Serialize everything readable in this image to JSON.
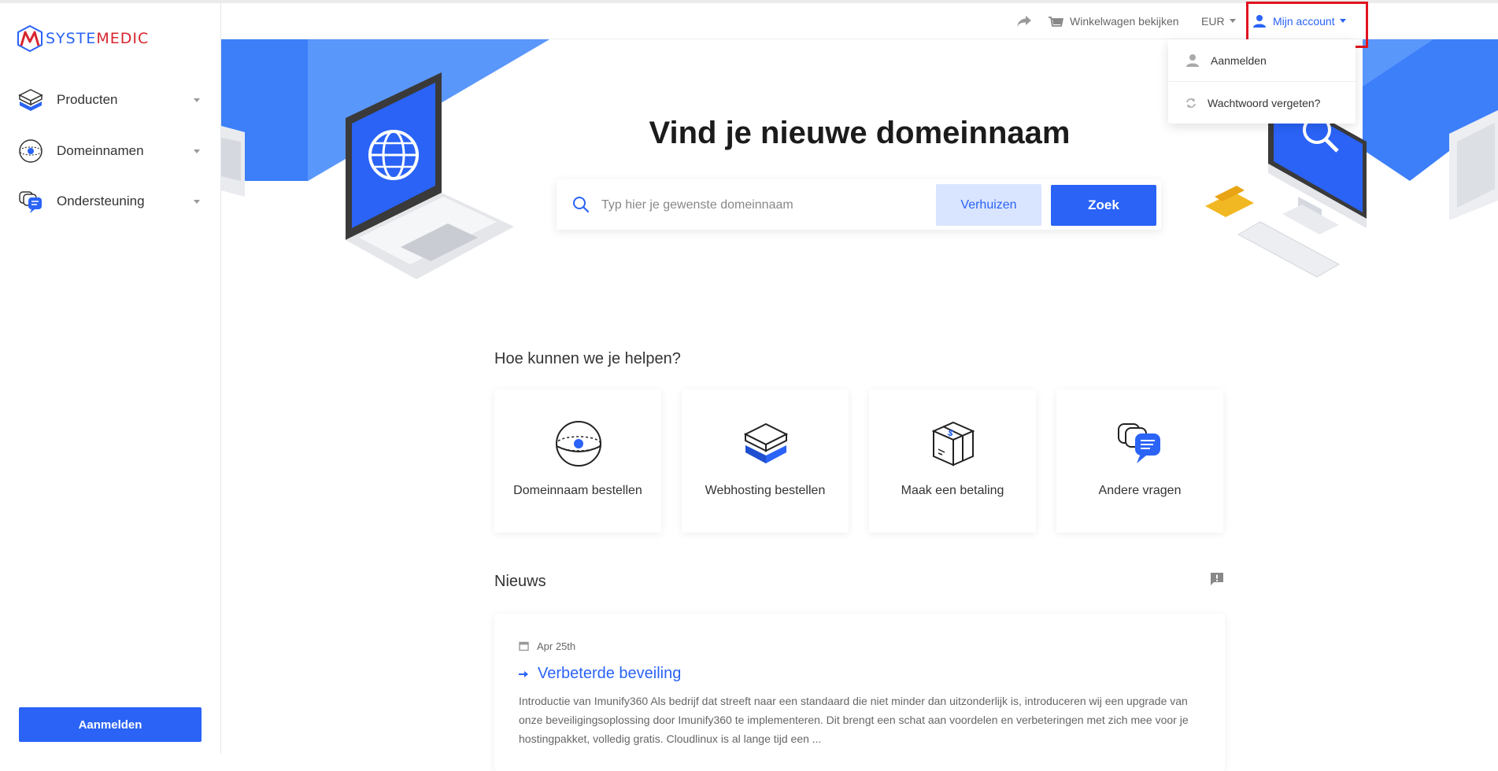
{
  "brand": {
    "logo_part1": "SYSTE",
    "logo_part2": "MEDIC",
    "primary_color": "#2a63f6",
    "accent_color": "#d7262f"
  },
  "sidebar": {
    "items": [
      {
        "label": "Producten",
        "icon": "server-icon"
      },
      {
        "label": "Domeinnamen",
        "icon": "globe-icon"
      },
      {
        "label": "Ondersteuning",
        "icon": "chat-bubbles-icon"
      }
    ],
    "login_button": "Aanmelden"
  },
  "topbar": {
    "cart_label": "Winkelwagen bekijken",
    "currency_label": "EUR",
    "account_label": "Mijn account"
  },
  "account_menu": {
    "items": [
      {
        "label": "Aanmelden",
        "icon": "user-icon"
      },
      {
        "label": "Wachtwoord vergeten?",
        "icon": "refresh-icon"
      }
    ]
  },
  "hero": {
    "title": "Vind je nieuwe domeinnaam",
    "search_placeholder": "Typ hier je gewenste domeinnaam",
    "transfer_button": "Verhuizen",
    "search_button": "Zoek"
  },
  "help": {
    "title": "Hoe kunnen we je helpen?",
    "cards": [
      {
        "label": "Domeinnaam bestellen",
        "icon": "globe-icon"
      },
      {
        "label": "Webhosting bestellen",
        "icon": "server-icon"
      },
      {
        "label": "Maak een betaling",
        "icon": "package-icon"
      },
      {
        "label": "Andere vragen",
        "icon": "chat-bubbles-icon"
      }
    ]
  },
  "news": {
    "title": "Nieuws",
    "items": [
      {
        "date": "Apr 25th",
        "title": "Verbeterde beveiling",
        "body": "Introductie van Imunify360 Als bedrijf dat streeft naar een standaard die niet minder dan uitzonderlijk is, introduceren wij een upgrade van onze beveiligingsoplossing door Imunify360 te implementeren. Dit brengt een schat aan voordelen en verbeteringen met zich mee voor je hostingpakket, volledig gratis.  Cloudlinux is al lange tijd een ..."
      }
    ]
  }
}
